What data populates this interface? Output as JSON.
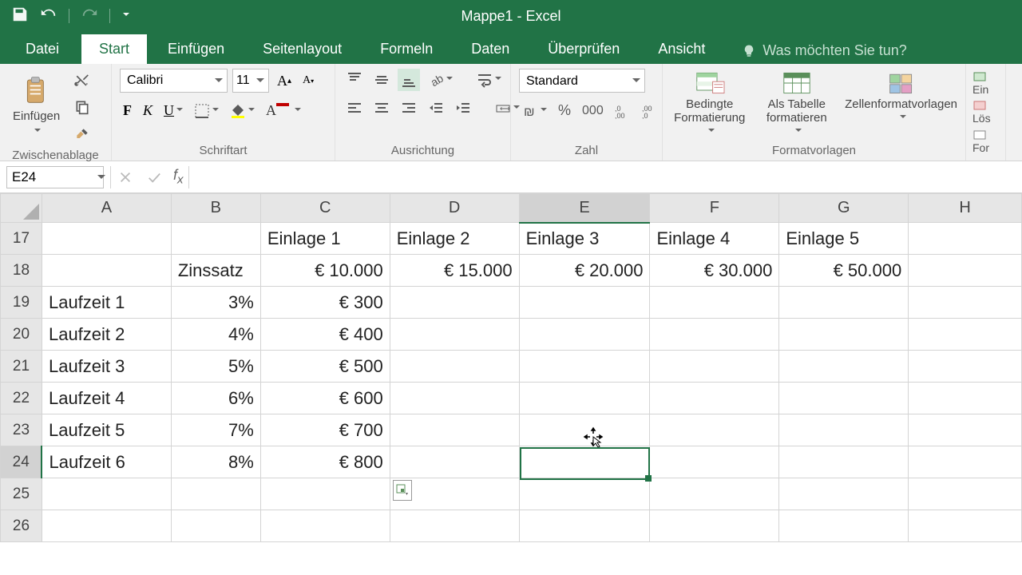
{
  "app": {
    "title": "Mappe1 - Excel"
  },
  "tabs": {
    "file": "Datei",
    "home": "Start",
    "insert": "Einfügen",
    "layout": "Seitenlayout",
    "formulas": "Formeln",
    "data": "Daten",
    "review": "Überprüfen",
    "view": "Ansicht",
    "tellme": "Was möchten Sie tun?"
  },
  "ribbon": {
    "clipboard": {
      "label": "Zwischenablage",
      "paste": "Einfügen"
    },
    "font": {
      "label": "Schriftart",
      "name": "Calibri",
      "size": "11",
      "bold": "F",
      "italic": "K",
      "underline": "U"
    },
    "alignment": {
      "label": "Ausrichtung"
    },
    "number": {
      "label": "Zahl",
      "format": "Standard"
    },
    "styles": {
      "label": "Formatvorlagen",
      "cond": "Bedingte",
      "cond2": "Formatierung",
      "table": "Als Tabelle",
      "table2": "formatieren",
      "cell": "Zellenformatvorlagen"
    },
    "cells": {
      "ins": "Ein",
      "del": "Lös",
      "fmt": "For"
    }
  },
  "fbar": {
    "name": "E24",
    "formula": ""
  },
  "sheet": {
    "columns": [
      "A",
      "B",
      "C",
      "D",
      "E",
      "F",
      "G",
      "H"
    ],
    "rows": [
      17,
      18,
      19,
      20,
      21,
      22,
      23,
      24,
      25,
      26
    ],
    "active_col": 4,
    "active_row": 24,
    "cells": {
      "B18": "Zinssatz",
      "C17": "Einlage 1",
      "D17": "Einlage 2",
      "E17": "Einlage 3",
      "F17": "Einlage 4",
      "G17": "Einlage 5",
      "C18": "€ 10.000",
      "D18": "€ 15.000",
      "E18": "€ 20.000",
      "F18": "€ 30.000",
      "G18": "€ 50.000",
      "A19": "Laufzeit 1",
      "B19": "3%",
      "C19": "€ 300",
      "A20": "Laufzeit 2",
      "B20": "4%",
      "C20": "€ 400",
      "A21": "Laufzeit 3",
      "B21": "5%",
      "C21": "€ 500",
      "A22": "Laufzeit 4",
      "B22": "6%",
      "C22": "€ 600",
      "A23": "Laufzeit 5",
      "B23": "7%",
      "C23": "€ 700",
      "A24": "Laufzeit 6",
      "B24": "8%",
      "C24": "€ 800"
    }
  }
}
